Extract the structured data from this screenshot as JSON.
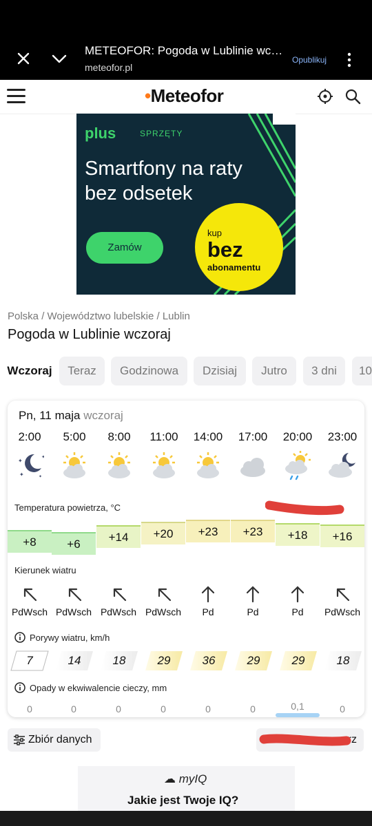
{
  "browser": {
    "title": "METEOFOR: Pogoda w Lublinie wc…",
    "url": "meteofor.pl",
    "publish_label": "Opublikuj"
  },
  "site": {
    "logo": "Meteofor"
  },
  "ad1": {
    "brand": "plus",
    "brand_sub": "SPRZĘTY",
    "headline_1": "Smartfony na raty",
    "headline_2": "bez odsetek",
    "cta": "Zamów",
    "badge_1": "kup",
    "badge_2": "bez",
    "badge_3": "abonamentu"
  },
  "breadcrumb": "Polska / Województwo lubelskie / Lublin",
  "page_title": "Pogoda w Lublinie wczoraj",
  "tabs": [
    "Wczoraj",
    "Teraz",
    "Godzinowa",
    "Dzisiaj",
    "Jutro",
    "3 dni",
    "10"
  ],
  "card": {
    "date": "Pn, 11 maja",
    "relative": "wczoraj",
    "hours": [
      "2:00",
      "5:00",
      "8:00",
      "11:00",
      "14:00",
      "17:00",
      "20:00",
      "23:00"
    ],
    "icons": [
      "moon-stars-icon",
      "sun-cloud-icon",
      "sun-cloud-icon",
      "sun-cloud-icon",
      "sun-cloud-icon",
      "cloud-icon",
      "sun-cloud-rain-icon",
      "moon-cloud-icon"
    ],
    "temp_label": "Temperatura powietrza, °C",
    "temps": [
      "+8",
      "+6",
      "+14",
      "+20",
      "+23",
      "+23",
      "+18",
      "+16"
    ],
    "wind_label": "Kierunek wiatru",
    "wind_dirs": [
      "PdWsch",
      "PdWsch",
      "PdWsch",
      "PdWsch",
      "Pd",
      "Pd",
      "Pd",
      "PdWsch"
    ],
    "gust_label": "Porywy wiatru, km/h",
    "gusts": [
      "7",
      "14",
      "18",
      "29",
      "36",
      "29",
      "29",
      "18"
    ],
    "precip_label": "Opady w ekwiwalencie cieczy, mm",
    "precip": [
      "0",
      "0",
      "0",
      "0",
      "0",
      "0",
      "0,1",
      "0"
    ]
  },
  "buttons": {
    "data_set": "Zbiór danych",
    "right_suffix": "rz"
  },
  "ad2": {
    "logo": "myIQ",
    "question": "Jakie jest Twoje IQ?"
  },
  "colors": {
    "accent": "#e8461f",
    "temp_green": "#c9f0c2",
    "temp_yellow": "#f7f3c0",
    "ad_green": "#3ed36b",
    "ad_yellow": "#f5e70a"
  }
}
